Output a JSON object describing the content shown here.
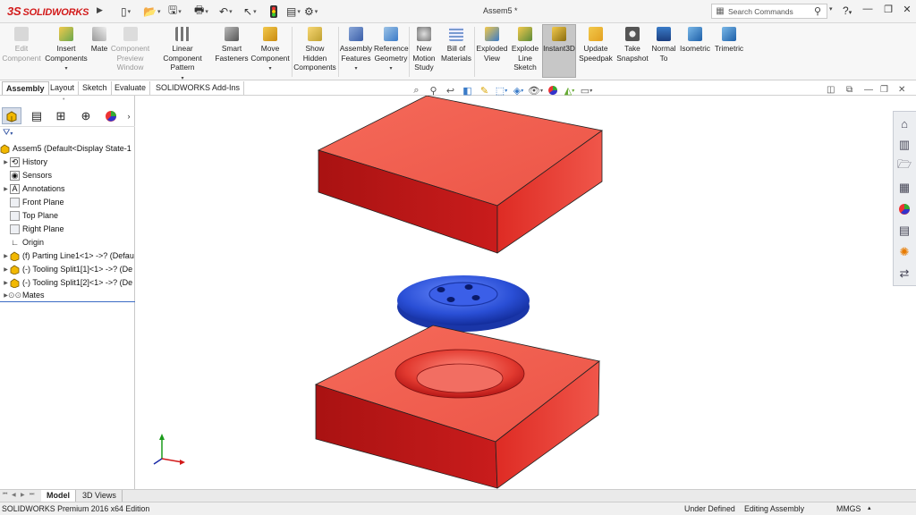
{
  "app": {
    "logo_ds": "3S",
    "logo_text": "SOLIDWORKS",
    "document_title": "Assem5 *",
    "search_placeholder": "Search Commands"
  },
  "command_manager": [
    {
      "label": "Edit\nComponent",
      "disabled": true,
      "icon": "edit-component-icon"
    },
    {
      "label": "Insert\nComponents",
      "icon": "insert-components-icon"
    },
    {
      "label": "Mate",
      "icon": "mate-icon"
    },
    {
      "label": "Component\nPreview\nWindow",
      "disabled": true,
      "icon": "preview-window-icon"
    },
    {
      "label": "Linear Component\nPattern",
      "icon": "linear-pattern-icon"
    },
    {
      "label": "Smart\nFasteners",
      "icon": "smart-fasteners-icon"
    },
    {
      "label": "Move\nComponent",
      "icon": "move-component-icon"
    },
    {
      "label": "Show\nHidden\nComponents",
      "icon": "show-hidden-icon"
    },
    {
      "label": "Assembly\nFeatures",
      "icon": "assembly-features-icon"
    },
    {
      "label": "Reference\nGeometry",
      "icon": "reference-geometry-icon"
    },
    {
      "label": "New\nMotion\nStudy",
      "icon": "motion-study-icon"
    },
    {
      "label": "Bill of\nMaterials",
      "icon": "bom-icon"
    },
    {
      "label": "Exploded\nView",
      "icon": "exploded-view-icon"
    },
    {
      "label": "Explode\nLine\nSketch",
      "icon": "explode-line-icon"
    },
    {
      "label": "Instant3D",
      "active": true,
      "icon": "instant3d-icon"
    },
    {
      "label": "Update\nSpeedpak",
      "icon": "speedpak-icon"
    },
    {
      "label": "Take\nSnapshot",
      "icon": "snapshot-icon"
    },
    {
      "label": "Normal\nTo",
      "icon": "normal-to-icon"
    },
    {
      "label": "Isometric",
      "icon": "isometric-icon"
    },
    {
      "label": "Trimetric",
      "icon": "trimetric-icon"
    }
  ],
  "tabs": [
    "Assembly",
    "Layout",
    "Sketch",
    "Evaluate",
    "SOLIDWORKS Add-Ins"
  ],
  "tree": {
    "root": "Assem5  (Default<Display State-1",
    "items": [
      {
        "label": "History",
        "expandable": true
      },
      {
        "label": "Sensors",
        "expandable": false
      },
      {
        "label": "Annotations",
        "expandable": true
      },
      {
        "label": "Front Plane",
        "expandable": false
      },
      {
        "label": "Top Plane",
        "expandable": false
      },
      {
        "label": "Right Plane",
        "expandable": false
      },
      {
        "label": "Origin",
        "expandable": false
      },
      {
        "label": "(f) Parting Line1<1> ->? (Defau",
        "expandable": true
      },
      {
        "label": "(-) Tooling Split1[1]<1> ->? (De",
        "expandable": true
      },
      {
        "label": "(-) Tooling Split1[2]<1> ->? (De",
        "expandable": true
      },
      {
        "label": "Mates",
        "expandable": true
      }
    ]
  },
  "bottom_tabs": [
    "Model",
    "3D Views"
  ],
  "status": {
    "edition": "SOLIDWORKS Premium 2016 x64 Edition",
    "definition": "Under Defined",
    "mode": "Editing Assembly",
    "units": "MMGS"
  },
  "colors": {
    "mold": "#e8453c",
    "button_part": "#2a4fd6",
    "accent": "#d21a1a"
  }
}
